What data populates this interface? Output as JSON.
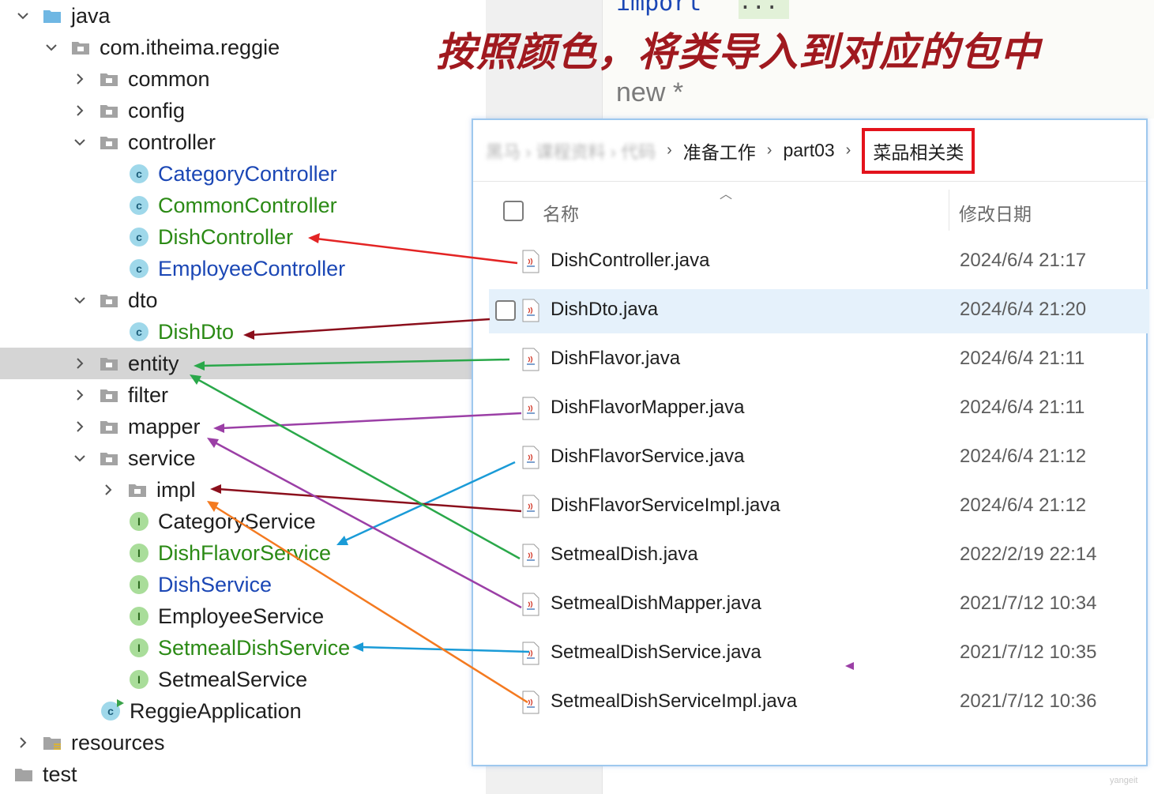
{
  "editor": {
    "import_text": "import",
    "dots": "...",
    "new_tab": "new *"
  },
  "heading": "按照颜色，将类导入到对应的包中",
  "tree": {
    "java": "java",
    "package": "com.itheima.reggie",
    "common": "common",
    "config": "config",
    "controller": "controller",
    "category_controller": "CategoryController",
    "common_controller": "CommonController",
    "dish_controller": "DishController",
    "employee_controller": "EmployeeController",
    "dto": "dto",
    "dish_dto": "DishDto",
    "entity": "entity",
    "filter": "filter",
    "mapper": "mapper",
    "service": "service",
    "impl": "impl",
    "category_service": "CategoryService",
    "dish_flavor_service": "DishFlavorService",
    "dish_service": "DishService",
    "employee_service": "EmployeeService",
    "setmeal_dish_service": "SetmealDishService",
    "setmeal_service": "SetmealService",
    "reggie_application": "ReggieApplication",
    "resources": "resources",
    "test": "test",
    "class_badge": "c",
    "interface_badge": "I"
  },
  "explorer": {
    "breadcrumb": {
      "blurred": "黑马 › 课程资料 › 代码",
      "prep": "准备工作",
      "part": "part03",
      "current": "菜品相关类"
    },
    "columns": {
      "name": "名称",
      "date": "修改日期"
    },
    "files": [
      {
        "name": "DishController.java",
        "date": "2024/6/4 21:17"
      },
      {
        "name": "DishDto.java",
        "date": "2024/6/4 21:20"
      },
      {
        "name": "DishFlavor.java",
        "date": "2024/6/4 21:11"
      },
      {
        "name": "DishFlavorMapper.java",
        "date": "2024/6/4 21:11"
      },
      {
        "name": "DishFlavorService.java",
        "date": "2024/6/4 21:12"
      },
      {
        "name": "DishFlavorServiceImpl.java",
        "date": "2024/6/4 21:12"
      },
      {
        "name": "SetmealDish.java",
        "date": "2022/2/19 22:14"
      },
      {
        "name": "SetmealDishMapper.java",
        "date": "2021/7/12 10:34"
      },
      {
        "name": "SetmealDishService.java",
        "date": "2021/7/12 10:35"
      },
      {
        "name": "SetmealDishServiceImpl.java",
        "date": "2021/7/12 10:36"
      }
    ]
  },
  "colors": {
    "red": "#e32424",
    "dark_red": "#8b0f1c",
    "green": "#2aa84a",
    "purple": "#9b3fa6",
    "blue": "#1a9bd7",
    "orange": "#f47a20"
  },
  "watermark": "yangeit"
}
